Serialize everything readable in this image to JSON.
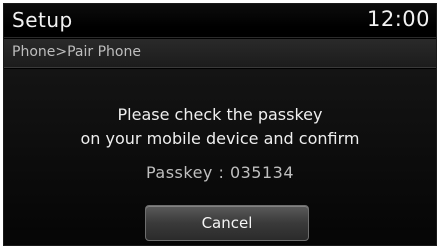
{
  "header": {
    "title": "Setup",
    "clock": "12:00"
  },
  "breadcrumb": {
    "text": "Phone>Pair Phone"
  },
  "dialog": {
    "message_line1": "Please check the passkey",
    "message_line2": "on your mobile device and confirm",
    "passkey_text": "Passkey : 035134",
    "cancel_label": "Cancel"
  },
  "colors": {
    "background": "#000000",
    "text": "#efefef",
    "muted_text": "#bfbfbf",
    "button": "#3a3a3a"
  }
}
